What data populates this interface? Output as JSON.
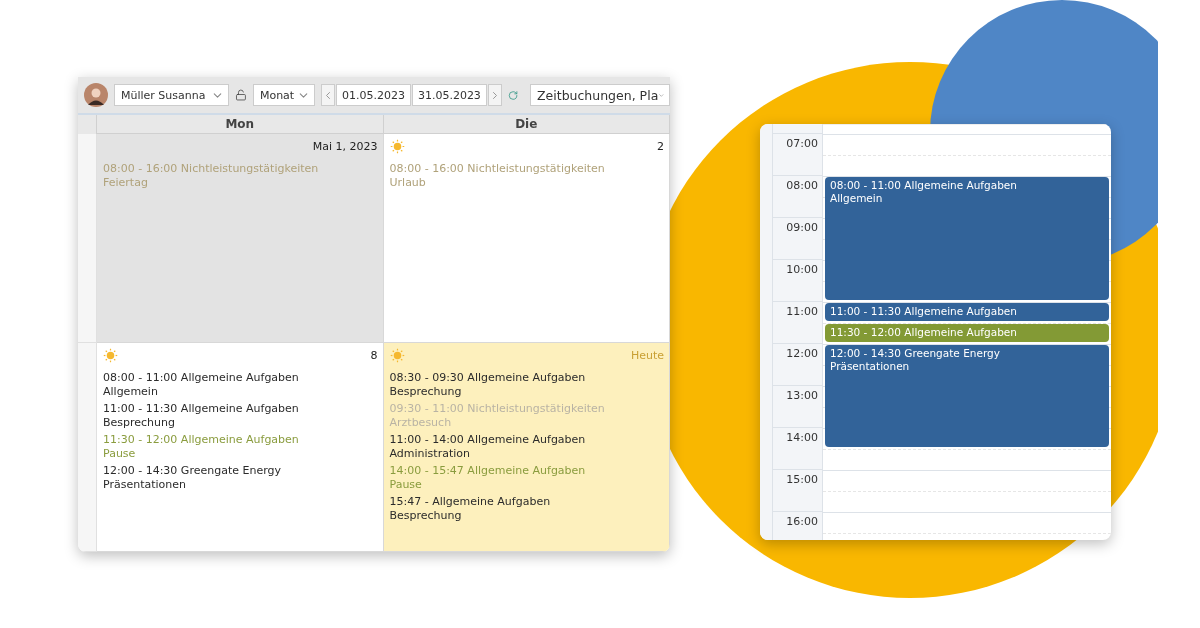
{
  "toolbar": {
    "employee": "Müller Susanna",
    "view": "Monat",
    "date_from": "01.05.2023",
    "date_to": "31.05.2023",
    "filter": "Zeitbuchungen, Pla"
  },
  "month": {
    "columns": [
      "Mon",
      "Die"
    ],
    "cells": [
      {
        "label": "Mai 1, 2023",
        "kind": "holiday",
        "sun": false,
        "entries": [
          {
            "kind": "absence",
            "line": "08:00 - 16:00 Nichtleistungstätigkeiten",
            "detail": "Feiertag"
          }
        ]
      },
      {
        "label": "2",
        "kind": "normal",
        "sun": true,
        "entries": [
          {
            "kind": "absence",
            "line": "08:00 - 16:00 Nichtleistungstätigkeiten",
            "detail": "Urlaub"
          }
        ]
      },
      {
        "label": "8",
        "kind": "normal",
        "sun": true,
        "entries": [
          {
            "kind": "work",
            "line": "08:00 - 11:00 Allgemeine Aufgaben",
            "detail": "Allgemein"
          },
          {
            "kind": "work",
            "line": "11:00 - 11:30 Allgemeine Aufgaben",
            "detail": "Besprechung"
          },
          {
            "kind": "break",
            "line": "11:30 - 12:00 Allgemeine Aufgaben",
            "detail": "Pause"
          },
          {
            "kind": "work",
            "line": "12:00 - 14:30 Greengate Energy",
            "detail": "Präsentationen"
          }
        ]
      },
      {
        "label": "Heute",
        "kind": "today",
        "sun": true,
        "entries": [
          {
            "kind": "work",
            "line": "08:30 - 09:30 Allgemeine Aufgaben",
            "detail": "Besprechung"
          },
          {
            "kind": "leave",
            "line": "09:30 - 11:00 Nichtleistungstätigkeiten",
            "detail": "Arztbesuch"
          },
          {
            "kind": "work",
            "line": "11:00 - 14:00 Allgemeine Aufgaben",
            "detail": "Administration"
          },
          {
            "kind": "break",
            "line": "14:00 - 15:47 Allgemeine Aufgaben",
            "detail": "Pause"
          },
          {
            "kind": "work",
            "line": "15:47 - Allgemeine Aufgaben",
            "detail": "Besprechung"
          }
        ]
      }
    ]
  },
  "day": {
    "hours": [
      "07:00",
      "08:00",
      "09:00",
      "10:00",
      "11:00",
      "12:00",
      "13:00",
      "14:00",
      "15:00",
      "16:00"
    ],
    "events": [
      {
        "kind": "work",
        "time": "08:00 - 11:00",
        "title": "Allgemeine Aufgaben",
        "detail": "Allgemein"
      },
      {
        "kind": "work",
        "time": "11:00 - 11:30",
        "title": "Allgemeine Aufgaben"
      },
      {
        "kind": "break",
        "time": "11:30 - 12:00",
        "title": "Allgemeine Aufgaben"
      },
      {
        "kind": "work",
        "time": "12:00 - 14:30",
        "title": "Greengate Energy",
        "detail": "Präsentationen"
      }
    ]
  }
}
